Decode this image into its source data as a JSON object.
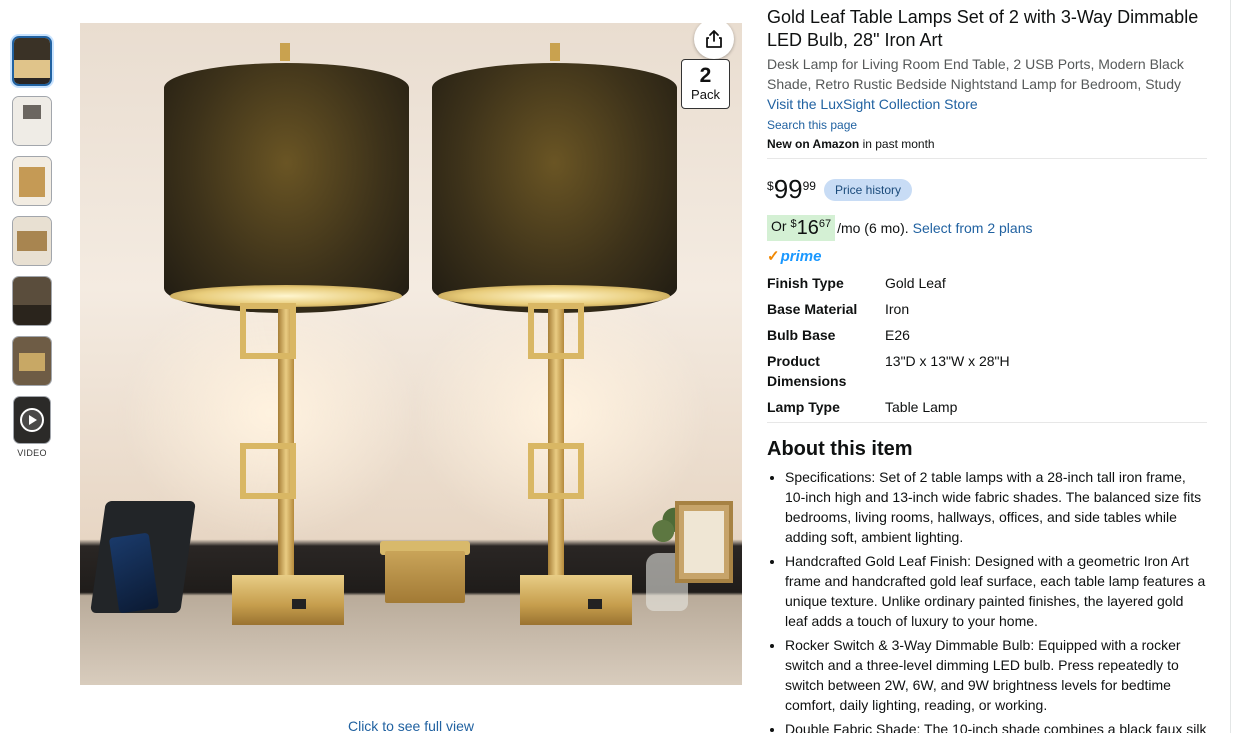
{
  "gallery": {
    "video_label": "VIDEO",
    "click_full_view": "Click to see full view",
    "pack_number": "2",
    "pack_label": "Pack"
  },
  "product": {
    "title": "Gold Leaf Table Lamps Set of 2 with 3-Way Dimmable LED Bulb, 28\" Iron Art",
    "subtitle": "Desk Lamp for Living Room End Table, 2 USB Ports, Modern Black Shade, Retro Rustic Bedside Nightstand Lamp for Bedroom, Study",
    "store_link": "Visit the LuxSight Collection Store",
    "search_link": "Search this page",
    "new_on_bold": "New on Amazon",
    "new_on_rest": " in past month"
  },
  "price": {
    "symbol": "$",
    "whole": "99",
    "fraction": "99",
    "history_label": "Price history",
    "monthly_prefix": "Or ",
    "monthly_symbol": "$",
    "monthly_whole": "16",
    "monthly_fraction": "67",
    "monthly_suffix": "/mo (6 mo).",
    "plans_link": "Select from 2 plans",
    "prime_label": "prime"
  },
  "specs": [
    {
      "key": "Finish Type",
      "value": "Gold Leaf"
    },
    {
      "key": "Base Material",
      "value": "Iron"
    },
    {
      "key": "Bulb Base",
      "value": "E26"
    },
    {
      "key": "Product Dimensions",
      "value": "13\"D x 13\"W x 28\"H"
    },
    {
      "key": "Lamp Type",
      "value": "Table Lamp"
    }
  ],
  "about": {
    "heading": "About this item",
    "bullets": [
      "Specifications: Set of 2 table lamps with a 28-inch tall iron frame, 10-inch high and 13-inch wide fabric shades. The balanced size fits bedrooms, living rooms, hallways, offices, and side tables while adding soft, ambient lighting.",
      "Handcrafted Gold Leaf Finish: Designed with a geometric Iron Art frame and handcrafted gold leaf surface, each table lamp features a unique texture. Unlike ordinary painted finishes, the layered gold leaf adds a touch of luxury to your home.",
      "Rocker Switch & 3-Way Dimmable Bulb: Equipped with a rocker switch and a three-level dimming LED bulb. Press repeatedly to switch between 2W, 6W, and 9W brightness levels for bedtime comfort, daily lighting, reading, or working.",
      "Double Fabric Shade: The 10-inch shade combines a black faux silk"
    ]
  },
  "icons": {
    "share": "share-icon",
    "play": "play-icon",
    "prime": "prime-check-icon"
  }
}
